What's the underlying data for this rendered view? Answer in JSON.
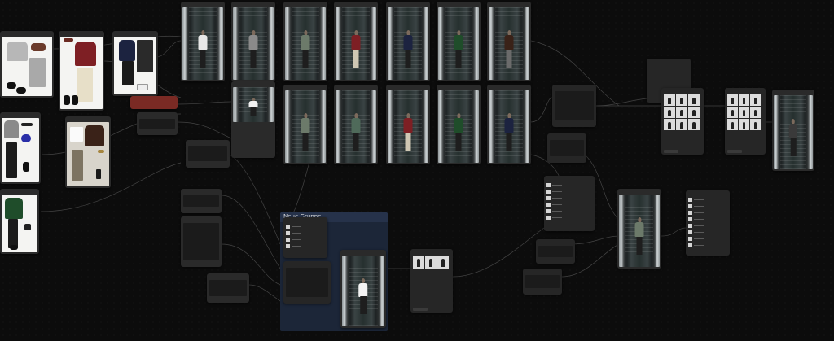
{
  "group": {
    "title": "Neue Gruppe"
  },
  "colors": {
    "canvas": "#0c0c0c",
    "group_bg": "#1c2638",
    "node_bg": "#2a2a2a",
    "accent_node": "#7a2a24",
    "wire": "#5b5b5b"
  },
  "icons": {
    "node_header": "node-title-bar",
    "run_button": "queue-button"
  }
}
